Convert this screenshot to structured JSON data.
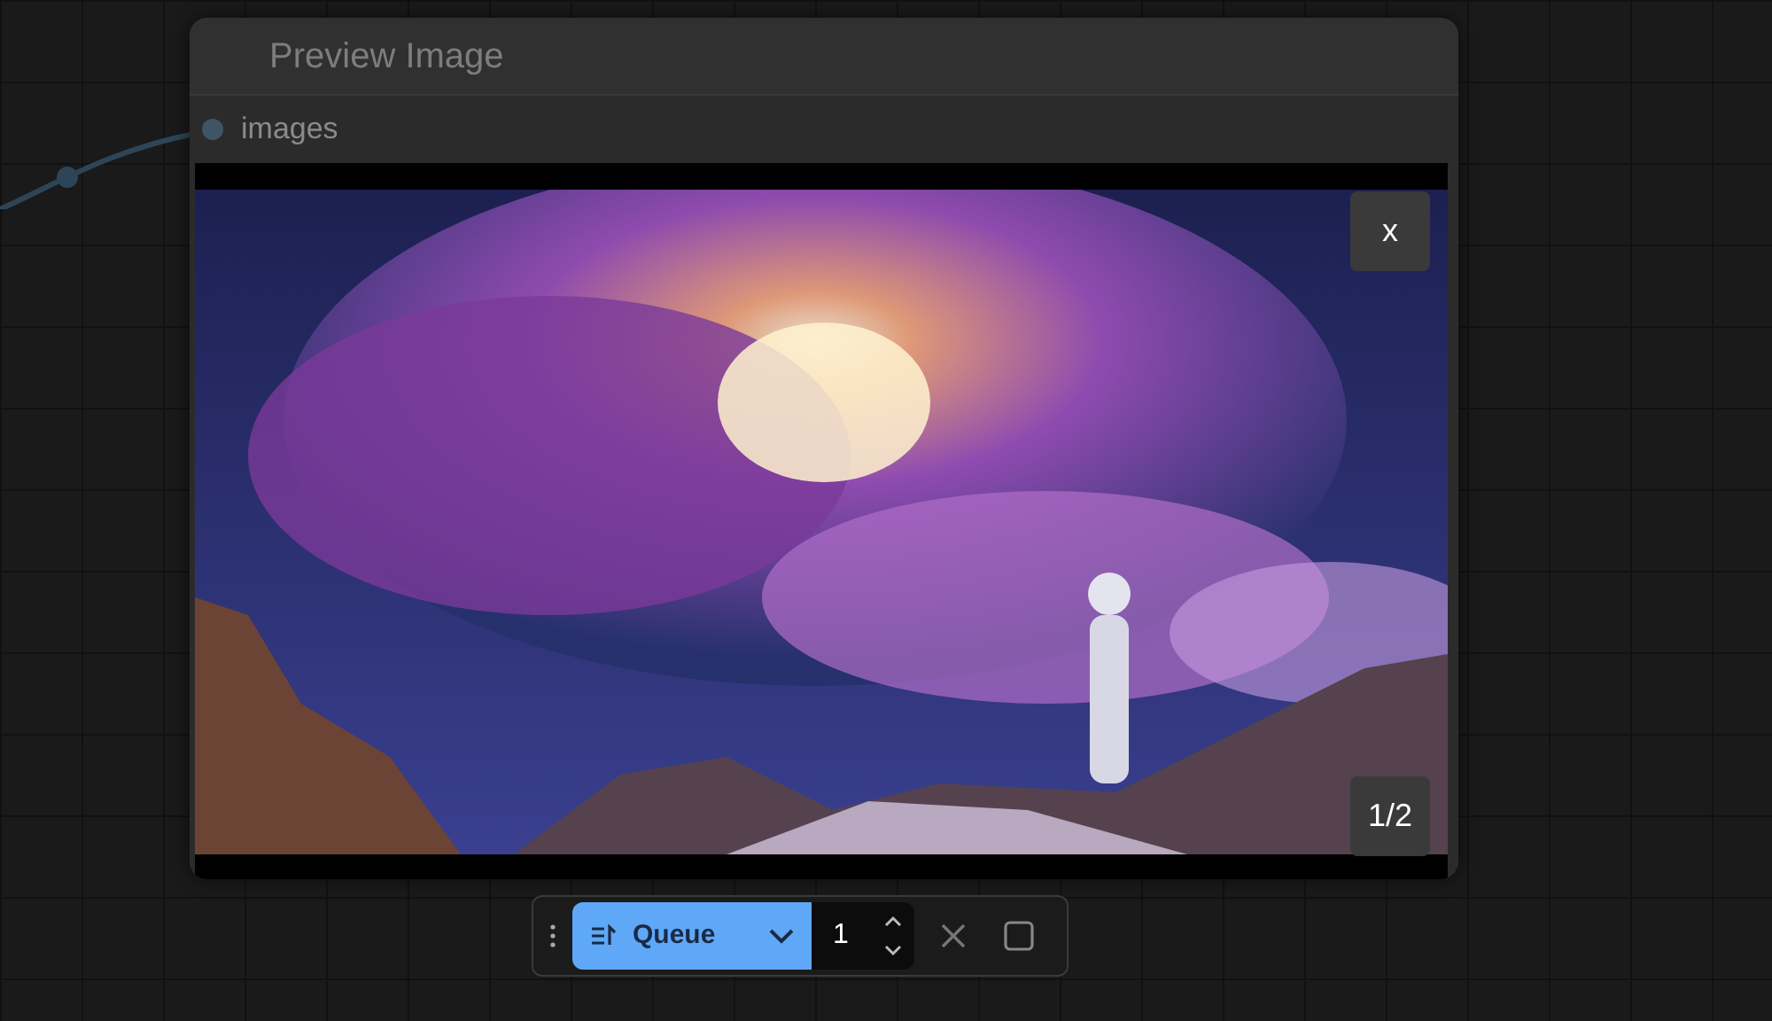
{
  "node": {
    "title": "Preview Image",
    "slot_label": "images",
    "preview": {
      "kind": "picture",
      "close_label": "x",
      "counter": "1/2"
    }
  },
  "toolbar": {
    "run_button": {
      "label": "Queue"
    },
    "batch_count": "1"
  }
}
